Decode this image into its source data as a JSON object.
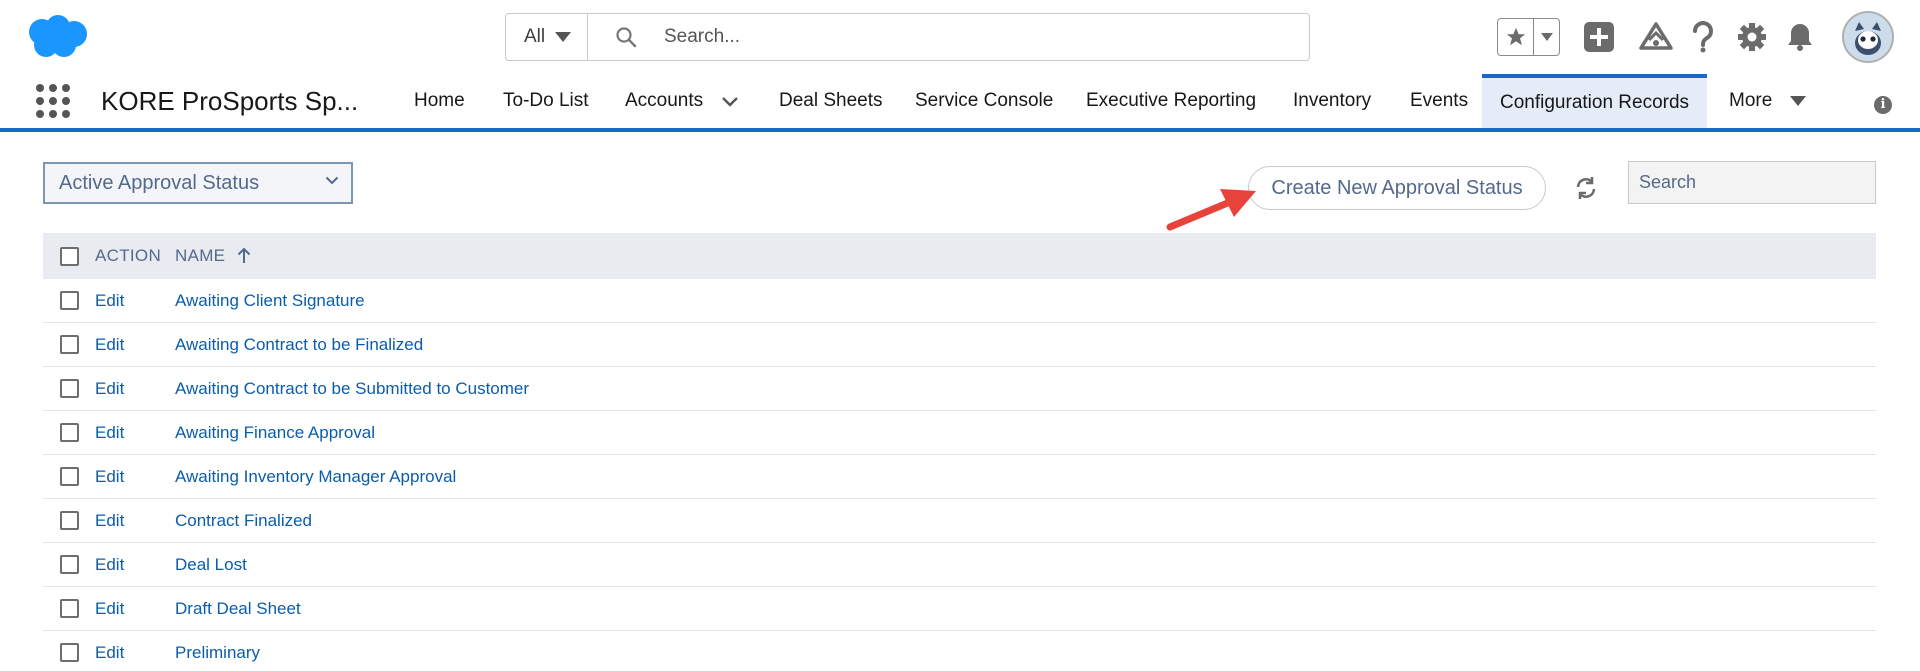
{
  "header": {
    "search_scope": "All",
    "search_placeholder": "Search..."
  },
  "nav": {
    "app_name": "KORE ProSports Sp...",
    "items": [
      {
        "label": "Home"
      },
      {
        "label": "To-Do List"
      },
      {
        "label": "Accounts"
      },
      {
        "label": "Deal Sheets"
      },
      {
        "label": "Service Console"
      },
      {
        "label": "Executive Reporting"
      },
      {
        "label": "Inventory"
      },
      {
        "label": "Events"
      },
      {
        "label": "Configuration Records"
      },
      {
        "label": "More"
      }
    ],
    "active_index": 8
  },
  "toolbar": {
    "list_view": "Active Approval Status",
    "create_button": "Create New Approval Status",
    "search_placeholder": "Search"
  },
  "table": {
    "columns": [
      "ACTION",
      "NAME"
    ],
    "sort_column": "NAME",
    "sort_direction": "ascending",
    "rows": [
      {
        "action": "Edit",
        "name": "Awaiting Client Signature"
      },
      {
        "action": "Edit",
        "name": "Awaiting Contract to be Finalized"
      },
      {
        "action": "Edit",
        "name": "Awaiting Contract to be Submitted to Customer"
      },
      {
        "action": "Edit",
        "name": "Awaiting Finance Approval"
      },
      {
        "action": "Edit",
        "name": "Awaiting Inventory Manager Approval"
      },
      {
        "action": "Edit",
        "name": "Contract Finalized"
      },
      {
        "action": "Edit",
        "name": "Deal Lost"
      },
      {
        "action": "Edit",
        "name": "Draft Deal Sheet"
      },
      {
        "action": "Edit",
        "name": "Preliminary"
      }
    ]
  },
  "colors": {
    "brand": "#1b96ff",
    "nav_accent": "#1b67c6",
    "link": "#0b5cab",
    "annotation_arrow": "#e8433a"
  },
  "icons": {
    "header": [
      "salesforce-cloud-logo",
      "search-icon",
      "star-icon",
      "add-icon",
      "trailhead-icon",
      "help-icon",
      "gear-icon",
      "bell-icon",
      "avatar"
    ],
    "toolbar": [
      "chevron-down-icon",
      "refresh-icon"
    ],
    "table": [
      "sort-arrow-up-icon",
      "checkbox"
    ]
  }
}
